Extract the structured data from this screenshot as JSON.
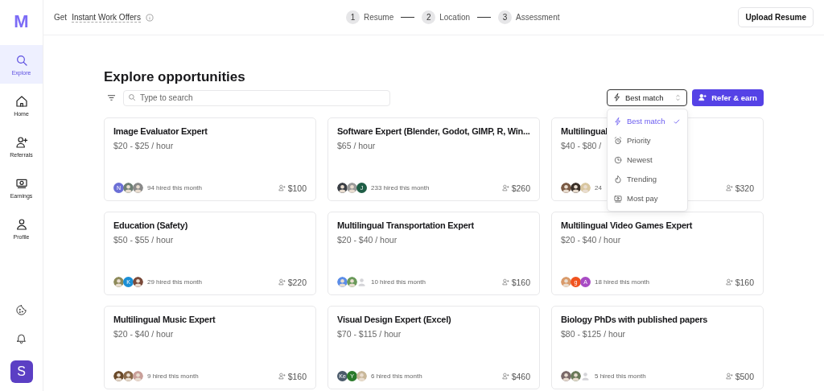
{
  "sidebar": {
    "logo": "M",
    "items": [
      {
        "label": "Explore",
        "selected": true
      },
      {
        "label": "Home",
        "selected": false
      },
      {
        "label": "Referrals",
        "selected": false
      },
      {
        "label": "Earnings",
        "selected": false
      },
      {
        "label": "Profile",
        "selected": false
      }
    ],
    "user_initial": "S"
  },
  "header": {
    "prefix": "Get",
    "link": "Instant Work Offers",
    "steps": [
      {
        "number": "1",
        "label": "Resume"
      },
      {
        "number": "2",
        "label": "Location"
      },
      {
        "number": "3",
        "label": "Assessment"
      }
    ],
    "upload_button": "Upload Resume"
  },
  "title": "Explore opportunities",
  "search": {
    "placeholder": "Type to search"
  },
  "sort": {
    "value": "Best match",
    "expanded": true,
    "options": [
      {
        "label": "Best match",
        "selected": true
      },
      {
        "label": "Priority",
        "selected": false
      },
      {
        "label": "Newest",
        "selected": false
      },
      {
        "label": "Trending",
        "selected": false
      },
      {
        "label": "Most pay",
        "selected": false
      }
    ]
  },
  "refer_button": "Refer & earn",
  "cards": [
    {
      "title": "Image Evaluator Expert",
      "rate": "$20 - $25 / hour",
      "avatars": [
        {
          "kind": "letter",
          "text": "N",
          "color": "#6b6fd6"
        },
        {
          "kind": "photo",
          "color": "#6d7f74"
        },
        {
          "kind": "photo",
          "color": "#8a8a8a"
        }
      ],
      "hired": "94 hired this month",
      "bonus": "$100"
    },
    {
      "title": "Software Expert (Blender, Godot, GIMP, R, Win...",
      "rate": "$65 / hour",
      "avatars": [
        {
          "kind": "photo",
          "color": "#3b3f45"
        },
        {
          "kind": "photo",
          "color": "#9a9a9a"
        },
        {
          "kind": "letter",
          "text": "J",
          "color": "#1f5e46"
        }
      ],
      "hired": "233 hired this month",
      "bonus": "$260"
    },
    {
      "title": "Multilingual",
      "rate": "$40 - $80 /",
      "avatars": [
        {
          "kind": "photo",
          "color": "#7a5a44"
        },
        {
          "kind": "photo",
          "color": "#3a3028"
        },
        {
          "kind": "photo",
          "color": "#d9c7a0"
        }
      ],
      "hired": "24",
      "bonus": "$320"
    },
    {
      "title": "Education (Safety)",
      "rate": "$50 - $55 / hour",
      "avatars": [
        {
          "kind": "photo",
          "color": "#8d8a5a"
        },
        {
          "kind": "letter",
          "text": "K",
          "color": "#1a8fd6"
        },
        {
          "kind": "photo",
          "color": "#7a4a3a"
        }
      ],
      "hired": "29 hired this month",
      "bonus": "$220"
    },
    {
      "title": "Multilingual Transportation Expert",
      "rate": "$20 - $40 / hour",
      "avatars": [
        {
          "kind": "photo",
          "color": "#5b8de8"
        },
        {
          "kind": "photo",
          "color": "#6a9a5a"
        },
        {
          "kind": "blank",
          "color": "#d4d4d8"
        }
      ],
      "hired": "10 hired this month",
      "bonus": "$160"
    },
    {
      "title": "Multilingual Video Games Expert",
      "rate": "$20 - $40 / hour",
      "avatars": [
        {
          "kind": "photo",
          "color": "#d99a6a"
        },
        {
          "kind": "letter",
          "text": "g",
          "color": "#f0521e"
        },
        {
          "kind": "letter",
          "text": "A",
          "color": "#a84bc4"
        }
      ],
      "hired": "18 hired this month",
      "bonus": "$160"
    },
    {
      "title": "Multilingual Music Expert",
      "rate": "$20 - $40 / hour",
      "avatars": [
        {
          "kind": "photo",
          "color": "#6a4a2a"
        },
        {
          "kind": "photo",
          "color": "#8a6a4a"
        },
        {
          "kind": "photo",
          "color": "#c9a09a"
        }
      ],
      "hired": "9 hired this month",
      "bonus": "$160"
    },
    {
      "title": "Visual Design Expert (Excel)",
      "rate": "$70 - $115 / hour",
      "avatars": [
        {
          "kind": "letter",
          "text": "Ke",
          "color": "#4a5a6a"
        },
        {
          "kind": "letter",
          "text": "Y",
          "color": "#2a7a2a"
        },
        {
          "kind": "photo",
          "color": "#c9b89a"
        }
      ],
      "hired": "6 hired this month",
      "bonus": "$460"
    },
    {
      "title": "Biology PhDs with published papers",
      "rate": "$80 - $125 / hour",
      "avatars": [
        {
          "kind": "photo",
          "color": "#7a6a6a"
        },
        {
          "kind": "photo",
          "color": "#6a7a5a"
        },
        {
          "kind": "blank",
          "color": "#d4d4d8"
        }
      ],
      "hired": "5 hired this month",
      "bonus": "$500"
    }
  ]
}
